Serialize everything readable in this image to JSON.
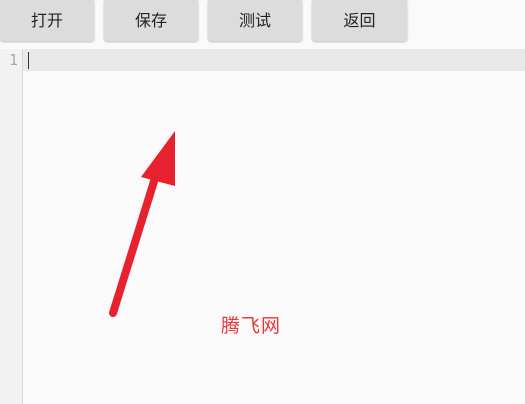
{
  "toolbar": {
    "open_label": "打开",
    "save_label": "保存",
    "test_label": "测试",
    "back_label": "返回"
  },
  "editor": {
    "line_numbers": [
      "1"
    ],
    "content": ""
  },
  "annotation": {
    "arrow_color": "#e8212e",
    "watermark": "腾飞网",
    "watermark_color": "#e5383b"
  }
}
